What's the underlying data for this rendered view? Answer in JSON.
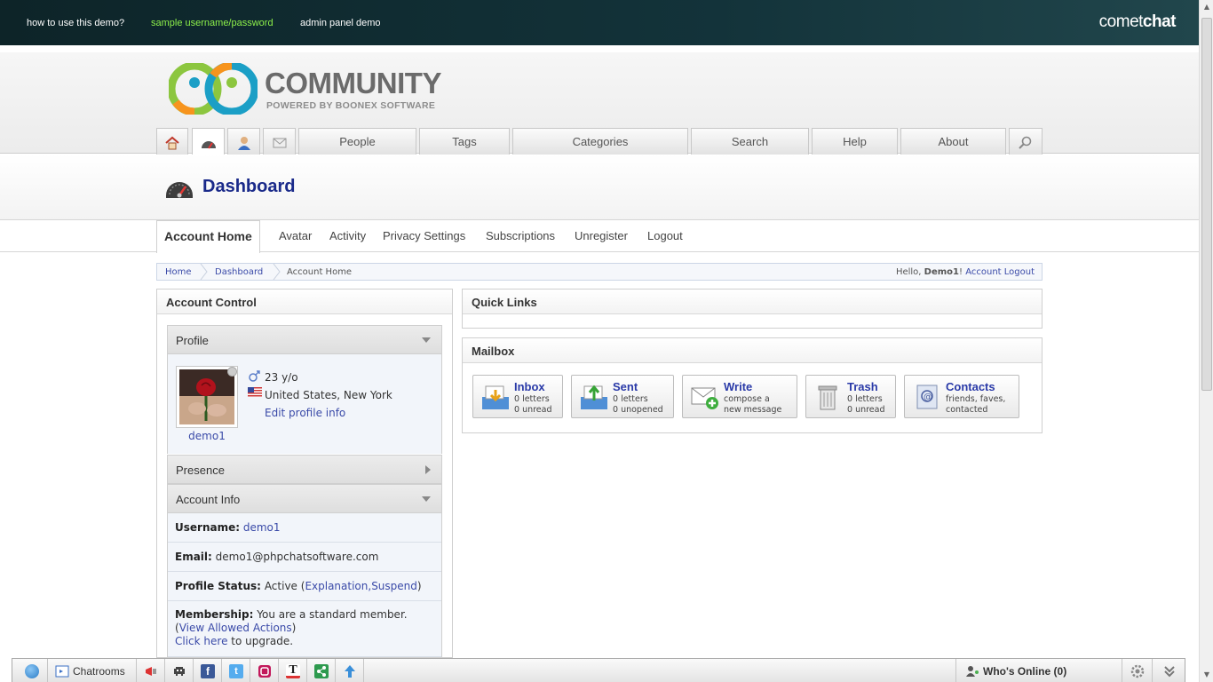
{
  "topbar": {
    "links": [
      "how to use this demo?",
      "sample username/password",
      "admin panel demo"
    ],
    "brand_light": "comet",
    "brand_bold": "chat"
  },
  "logo": {
    "word": "COMMUNITY",
    "sub": "POWERED BY BOONEX SOFTWARE"
  },
  "nav": {
    "icon_tabs": [
      "home-icon",
      "dashboard-icon",
      "profile-icon",
      "mail-icon"
    ],
    "tabs": [
      "People",
      "Tags",
      "Categories",
      "Search",
      "Help",
      "About"
    ],
    "search_icon": "search-icon"
  },
  "page": {
    "title": "Dashboard"
  },
  "subtabs": [
    "Account Home",
    "Avatar",
    "Activity",
    "Privacy Settings",
    "Subscriptions",
    "Unregister",
    "Logout"
  ],
  "breadcrumb": {
    "items": [
      "Home",
      "Dashboard",
      "Account Home"
    ],
    "hello_prefix": "Hello, ",
    "user": "Demo1",
    "hello_suffix": "! ",
    "logout": "Account Logout"
  },
  "account_control": {
    "title": "Account Control",
    "profile_header": "Profile",
    "age": "23 y/o",
    "location": "United States, New York",
    "edit_link": "Edit profile info",
    "username_caption": "demo1",
    "presence_header": "Presence",
    "account_info_header": "Account Info",
    "username_label": "Username:",
    "username_value": "demo1",
    "email_label": "Email:",
    "email_value": "demo1@phpchatsoftware.com",
    "status_label": "Profile Status:",
    "status_value": "Active (",
    "status_link1": "Explanation,",
    "status_link2": "Suspend",
    "status_close": ")",
    "membership_label": "Membership:",
    "membership_value": "You are a standard member.",
    "view_allowed_open": "(",
    "view_allowed": "View Allowed Actions",
    "view_allowed_close": ")",
    "click_here": "Click here",
    "upgrade": " to upgrade."
  },
  "quick_links": {
    "title": "Quick Links"
  },
  "mailbox": {
    "title": "Mailbox",
    "buttons": [
      {
        "title": "Inbox",
        "line1": "0 letters",
        "line2": "0 unread"
      },
      {
        "title": "Sent",
        "line1": "0 letters",
        "line2": "0 unopened"
      },
      {
        "title": "Write",
        "line1": "compose a",
        "line2": "new message"
      },
      {
        "title": "Trash",
        "line1": "0 letters",
        "line2": "0 unread"
      },
      {
        "title": "Contacts",
        "line1": "friends, faves,",
        "line2": "contacted"
      }
    ]
  },
  "chatbar": {
    "chatrooms": "Chatrooms",
    "whos_online": "Who's Online (0)"
  }
}
